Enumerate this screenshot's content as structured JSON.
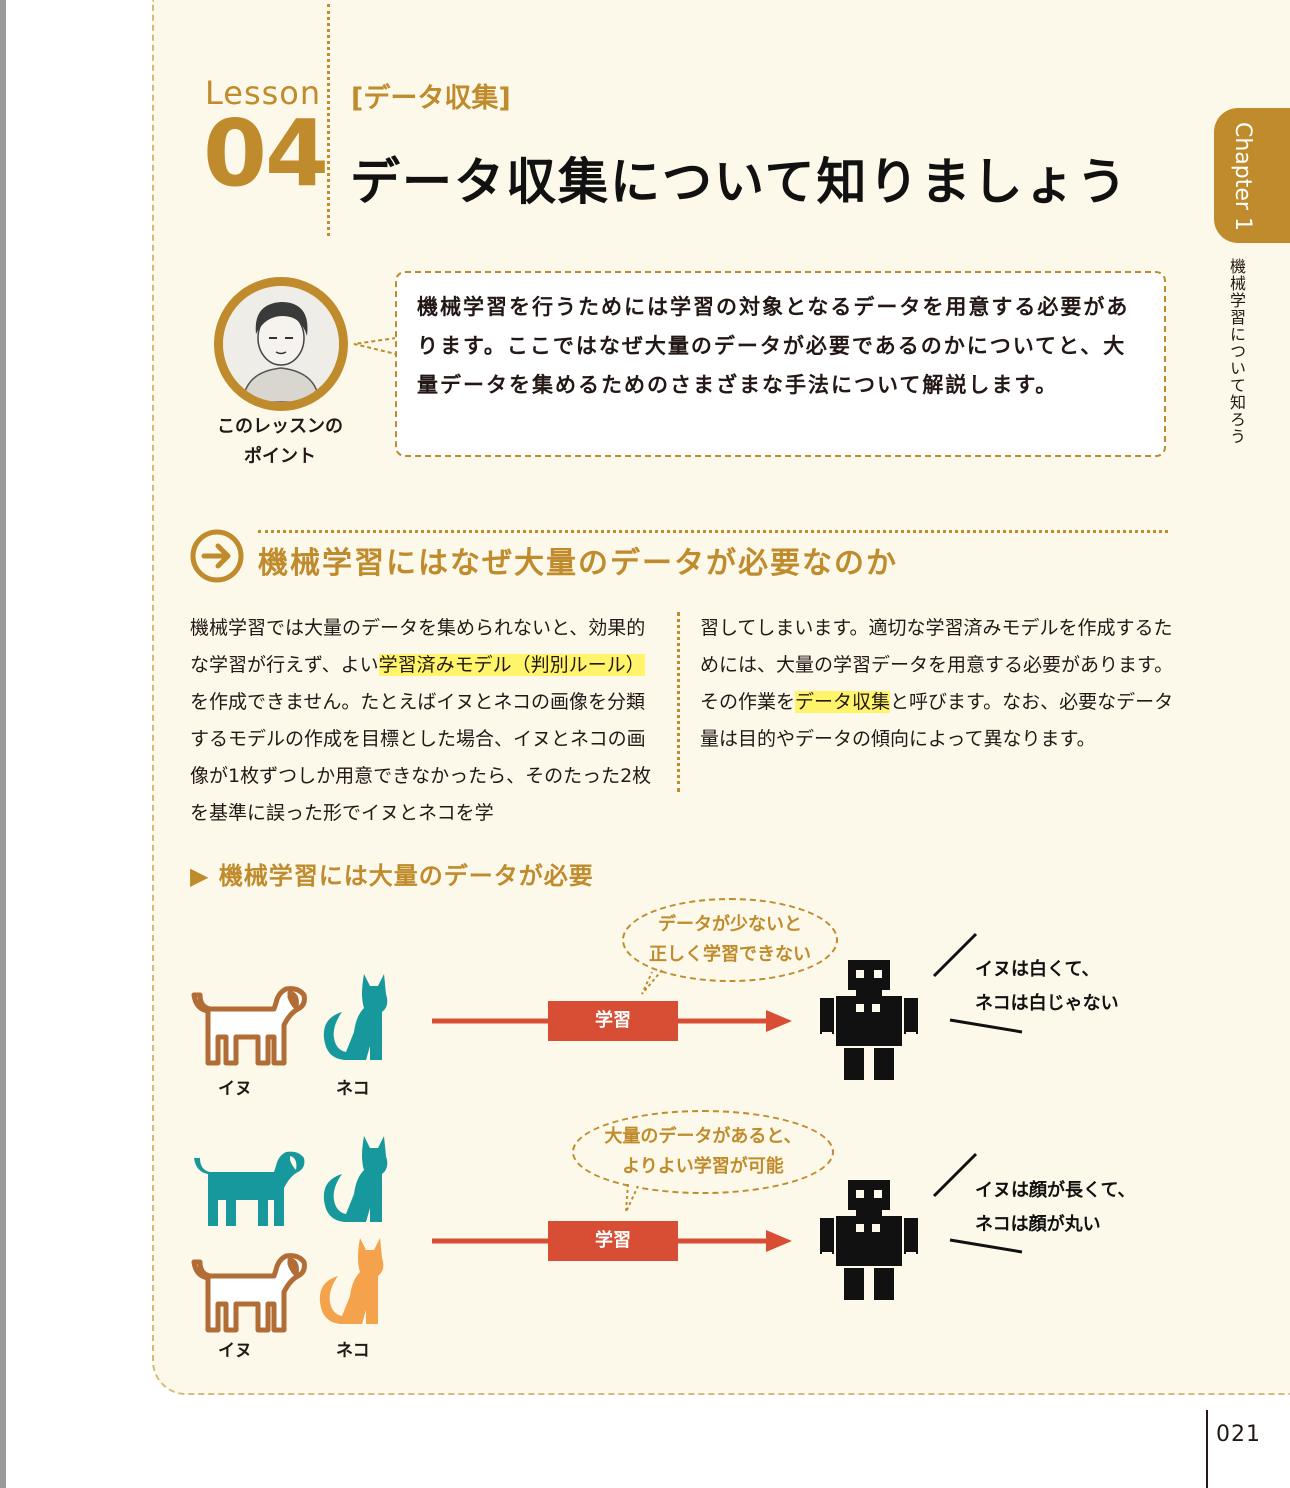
{
  "lesson": {
    "word": "Lesson",
    "number": "04",
    "category": "[データ収集]",
    "title": "データ収集について知りましょう"
  },
  "chapter": {
    "tab_label": "Chapter 1",
    "side_title": "機械学習について知ろう"
  },
  "intro": {
    "avatar_label_line1": "このレッスンの",
    "avatar_label_line2": "ポイント",
    "text": "機械学習を行うためには学習の対象となるデータを用意する必要があります。ここではなぜ大量のデータが必要であるのかについてと、大量データを集めるためのさまざまな手法について解説します。"
  },
  "section": {
    "heading": "機械学習にはなぜ大量のデータが必要なのか"
  },
  "body": {
    "left_p1": "機械学習では大量のデータを集められないと、効果的な学習が行えず、よい",
    "left_hl": "学習済みモデル（判別ルール）",
    "left_p2": "を作成できません。たとえばイヌとネコの画像を分類するモデルの作成を目標とした場合、イヌとネコの画像が1枚ずつしか用意できなかったら、そのたった2枚を基準に誤った形でイヌとネコを学",
    "right_p1": "習してしまいます。適切な学習済みモデルを作成するためには、大量の学習データを用意する必要があります。その作業を",
    "right_hl": "データ収集",
    "right_p2": "と呼びます。なお、必要なデータ量は目的やデータの傾向によって異なります。"
  },
  "figure": {
    "heading": "▶ 機械学習には大量のデータが必要",
    "row1": {
      "dog_label": "イヌ",
      "cat_label": "ネコ",
      "bubble_line1": "データが少ないと",
      "bubble_line2": "正しく学習できない",
      "learn_label": "学習",
      "result_line1": "イヌは白くて、",
      "result_line2": "ネコは白じゃない"
    },
    "row2": {
      "dog_label": "イヌ",
      "cat_label": "ネコ",
      "bubble_line1": "大量のデータがあると、",
      "bubble_line2": "よりよい学習が可能",
      "learn_label": "学習",
      "result_line1": "イヌは顔が長くて、",
      "result_line2": "ネコは顔が丸い"
    },
    "colors": {
      "teal": "#17989d",
      "brown": "#b26d36",
      "orange": "#f4a24b",
      "arrow_red": "#d84e34",
      "gold": "#c08b2c"
    }
  },
  "page_number": "021"
}
